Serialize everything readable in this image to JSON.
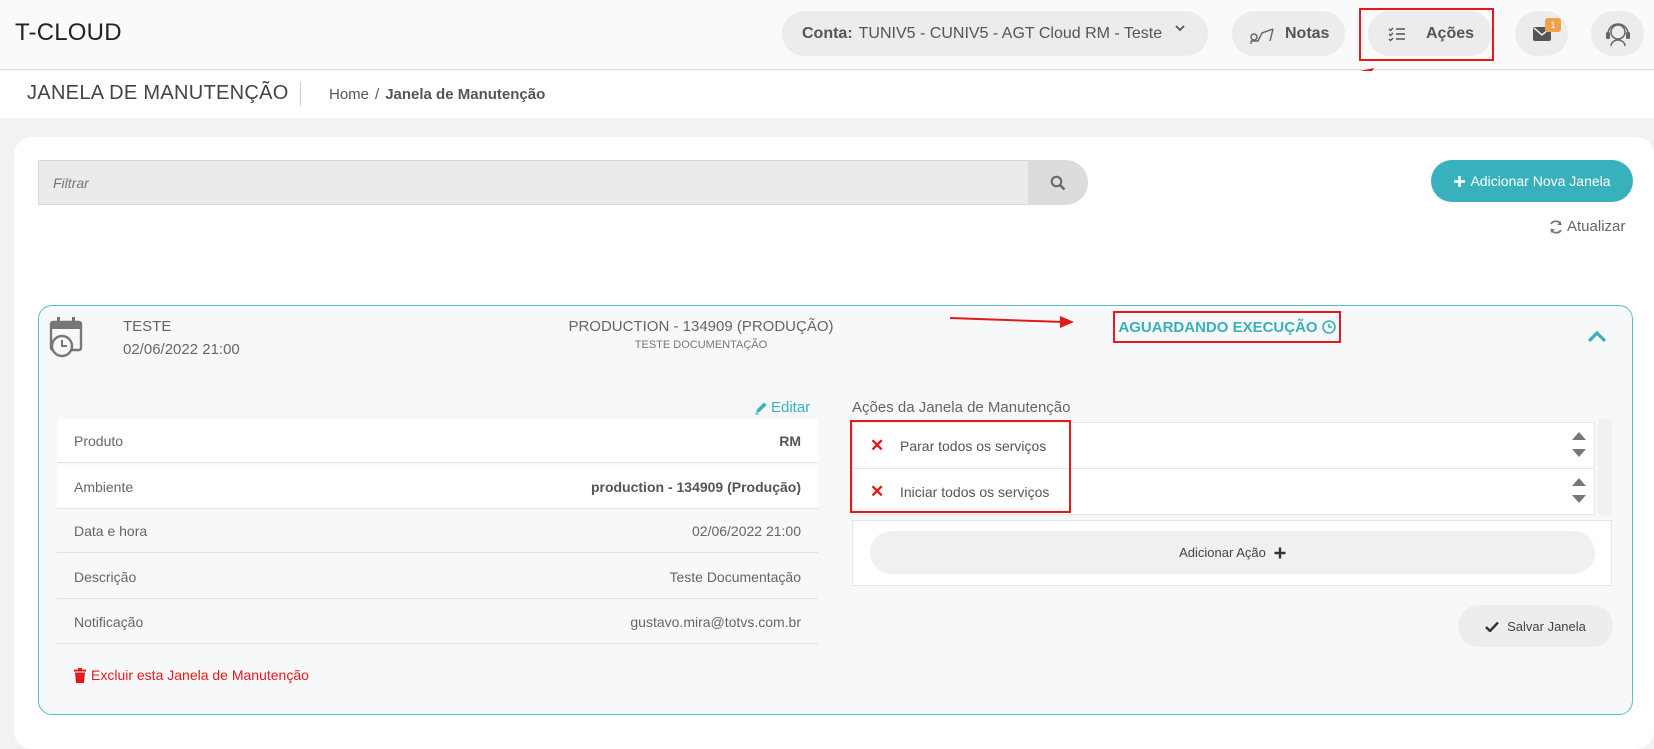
{
  "app": {
    "title": "T-CLOUD"
  },
  "topbar": {
    "account_label": "Conta:",
    "account_value": "TUNIV5 - CUNIV5 - AGT Cloud RM - Teste",
    "notas_label": "Notas",
    "acoes_label": "Ações",
    "mail_badge": "1"
  },
  "header": {
    "page_title": "JANELA DE MANUTENÇÃO",
    "breadcrumb": {
      "home": "Home",
      "separator": "/",
      "current": "Janela de Manutenção"
    }
  },
  "toolbar": {
    "filter_placeholder": "Filtrar",
    "add_button": "Adicionar Nova Janela",
    "refresh": "Atualizar"
  },
  "window": {
    "name": "TESTE",
    "date": "02/06/2022 21:00",
    "environment": "PRODUCTION - 134909 (PRODUÇÃO)",
    "description_upper": "TESTE DOCUMENTAÇÃO",
    "status": "AGUARDANDO EXECUÇÃO",
    "edit_label": "Editar",
    "details": [
      {
        "label": "Produto",
        "value": "RM"
      },
      {
        "label": "Ambiente",
        "value": "production - 134909 (Produção)"
      },
      {
        "label": "Data e hora",
        "value": "02/06/2022 21:00"
      },
      {
        "label": "Descrição",
        "value": "Teste Documentação"
      },
      {
        "label": "Notificação",
        "value": "gustavo.mira@totvs.com.br"
      }
    ],
    "delete_label": "Excluir esta Janela de Manutenção",
    "actions_title": "Ações da Janela de Manutenção",
    "actions": [
      {
        "label": "Parar todos os serviços"
      },
      {
        "label": "Iniciar todos os serviços"
      }
    ],
    "add_action": "Adicionar Ação",
    "save": "Salvar Janela"
  },
  "colors": {
    "accent": "#38b1bc",
    "danger": "#e21a1a",
    "annotation": "#e21a1a"
  }
}
